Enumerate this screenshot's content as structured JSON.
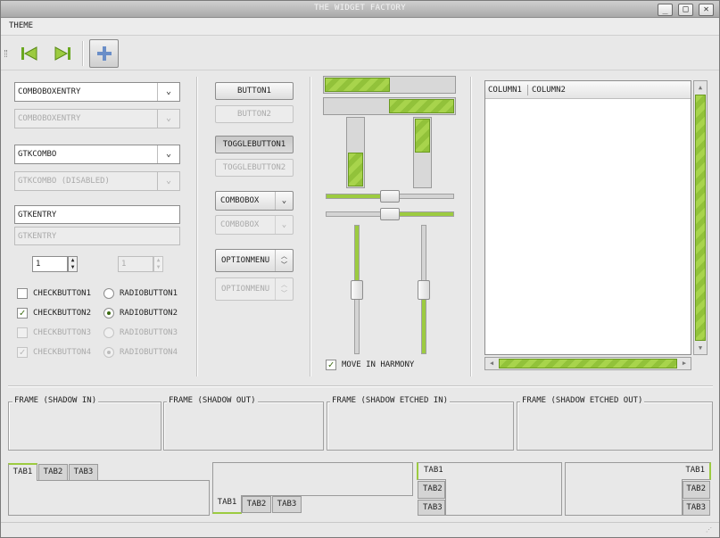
{
  "window": {
    "title": "THE WIDGET FACTORY",
    "btn_minimize": "_",
    "btn_maximize": "□",
    "btn_close": "✕"
  },
  "menubar": {
    "theme": "THEME"
  },
  "toolbar": {
    "first_icon": "go-first-icon",
    "last_icon": "go-last-icon",
    "add_icon": "add-icon"
  },
  "left": {
    "comboboxentry": "COMBOBOXENTRY",
    "comboboxentry_disabled": "COMBOBOXENTRY",
    "gtkcombo": "GTKCOMBO",
    "gtkcombo_disabled": "GTKCOMBO (DISABLED)",
    "gtkentry": "GTKENTRY",
    "gtkentry_disabled": "GTKENTRY",
    "spin1": "1",
    "spin2": "1",
    "checkbuttons": [
      "CHECKBUTTON1",
      "CHECKBUTTON2",
      "CHECKBUTTON3",
      "CHECKBUTTON4"
    ],
    "radiobuttons": [
      "RADIOBUTTON1",
      "RADIOBUTTON2",
      "RADIOBUTTON3",
      "RADIOBUTTON4"
    ]
  },
  "middle": {
    "button1": "BUTTON1",
    "button2": "BUTTON2",
    "togglebutton1": "TOGGLEBUTTON1",
    "togglebutton2": "TOGGLEBUTTON2",
    "combobox": "COMBOBOX",
    "combobox_disabled": "COMBOBOX",
    "optionmenu": "OPTIONMENU",
    "optionmenu_disabled": "OPTIONMENU"
  },
  "ranges": {
    "hprogress1": 0.5,
    "hprogress2": 0.5,
    "vprogress1": 0.5,
    "vprogress2": 0.5,
    "hscale1": 0.5,
    "hscale2": 0.5,
    "vscale1": 0.5,
    "vscale2": 0.5,
    "harmony_label": "MOVE IN HARMONY"
  },
  "tree": {
    "columns": [
      "COLUMN1",
      "COLUMN2"
    ]
  },
  "frames": [
    "FRAME (SHADOW IN)",
    "FRAME (SHADOW OUT)",
    "FRAME (SHADOW ETCHED IN)",
    "FRAME (SHADOW ETCHED OUT)"
  ],
  "tabs": [
    "TAB1",
    "TAB2",
    "TAB3"
  ],
  "colors": {
    "accent": "#9ccb40",
    "accent_dark": "#6a9a20"
  }
}
